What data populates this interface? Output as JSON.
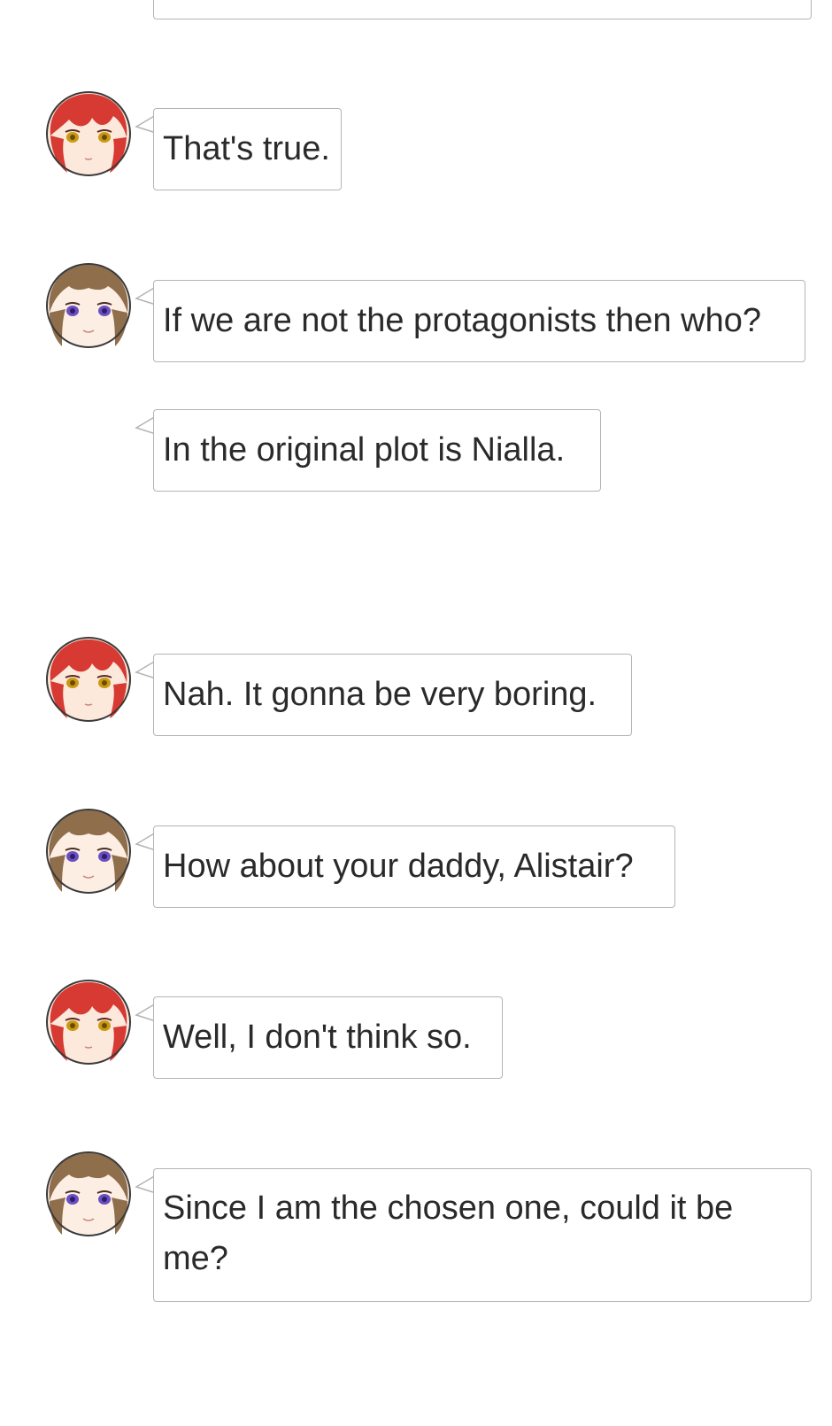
{
  "characters": {
    "redhead": {
      "hair": "#d63a32",
      "skin": "#fde8dc",
      "eyes": "#c99a10"
    },
    "brunette": {
      "hair": "#8e6e4b",
      "skin": "#fdeee4",
      "eyes": "#6a4fc2"
    }
  },
  "messages": [
    {
      "text": "That's true.",
      "speaker": "redhead"
    },
    {
      "text": "If we are not the protagonists then who?",
      "speaker": "brunette"
    },
    {
      "text": "In the original plot is Nialla.",
      "speaker": "none"
    },
    {
      "text": "Nah. It gonna be very boring.",
      "speaker": "redhead"
    },
    {
      "text": "How about your daddy, Alistair?",
      "speaker": "brunette"
    },
    {
      "text": "Well, I don't think so.",
      "speaker": "redhead"
    },
    {
      "text": "Since I am the chosen one, could it be me?",
      "speaker": "brunette"
    }
  ]
}
